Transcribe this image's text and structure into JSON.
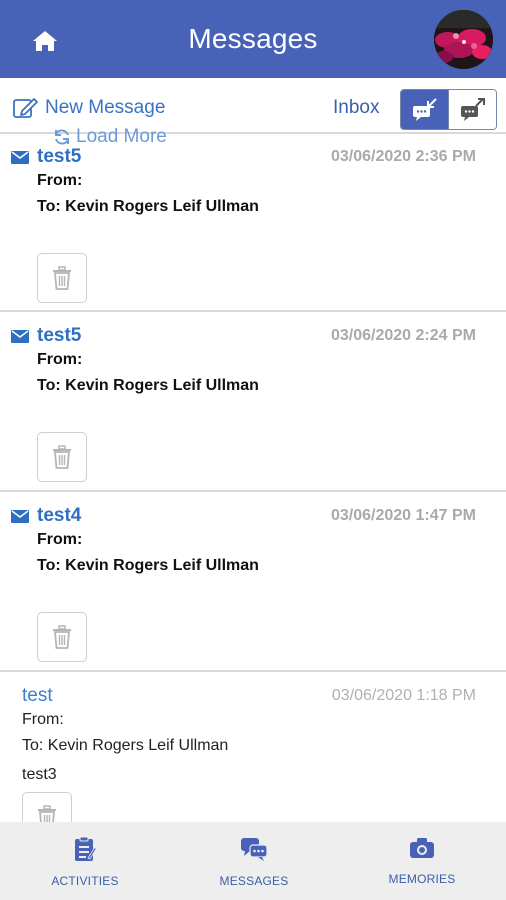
{
  "header": {
    "title": "Messages",
    "home_icon": "home-icon",
    "avatar": "profile-photo"
  },
  "toolbar": {
    "new_message_label": "New Message",
    "new_message_icon": "compose-icon",
    "folder_label": "Inbox",
    "inbox_toggle_icon": "inbox-chat-icon",
    "outbox_toggle_icon": "outbox-chat-icon",
    "active_view": "inbox"
  },
  "load_more_label": "Load More",
  "messages": [
    {
      "subject": "test5",
      "date": "03/06/2020 2:36 PM",
      "from": "From:",
      "to": "To: Kevin Rogers Leif Ullman",
      "body": "",
      "unread": true
    },
    {
      "subject": "test5",
      "date": "03/06/2020 2:24 PM",
      "from": "From:",
      "to": "To: Kevin Rogers Leif Ullman",
      "body": "",
      "unread": true
    },
    {
      "subject": "test4",
      "date": "03/06/2020 1:47 PM",
      "from": "From:",
      "to": "To: Kevin Rogers Leif Ullman",
      "body": "",
      "unread": true
    },
    {
      "subject": "test",
      "date": "03/06/2020 1:18 PM",
      "from": "From:",
      "to": "To: Kevin Rogers Leif Ullman",
      "body": "test3",
      "unread": false
    }
  ],
  "tabs": [
    {
      "label": "ACTIVITIES",
      "icon": "clipboard-icon"
    },
    {
      "label": "MESSAGES",
      "icon": "chat-bubbles-icon"
    },
    {
      "label": "MEMORIES",
      "icon": "camera-icon"
    }
  ],
  "colors": {
    "brand": "#4862b8",
    "link": "#2f6fc2",
    "muted": "#a9a9a9",
    "tabbar": "#eeeeee"
  }
}
